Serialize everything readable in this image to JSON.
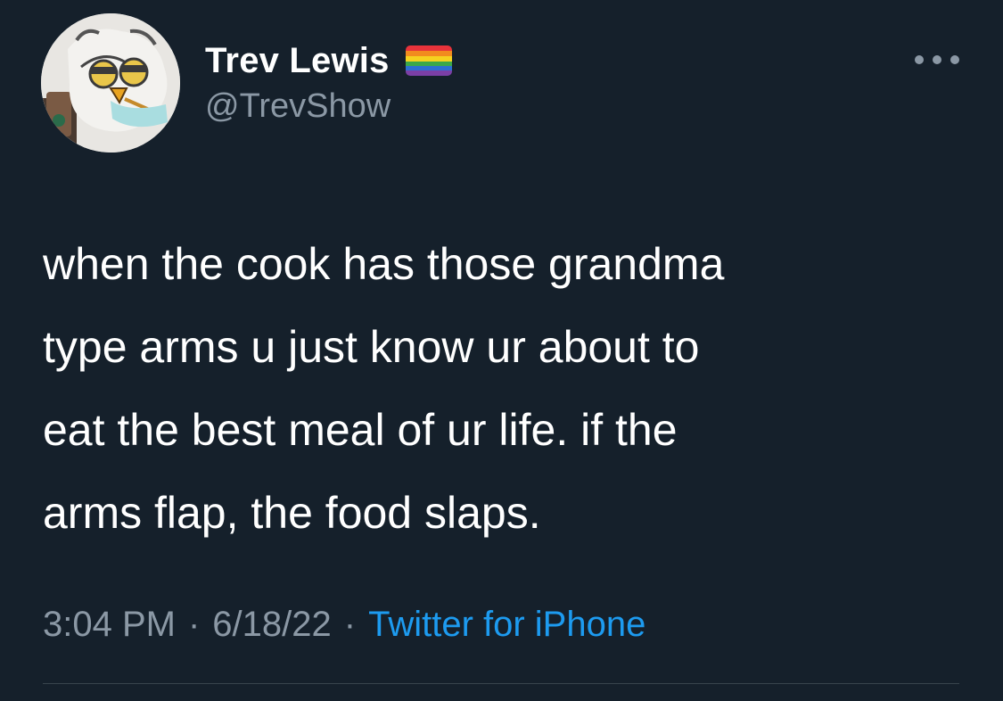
{
  "author": {
    "display_name": "Trev Lewis",
    "handle": "@TrevShow",
    "flag_icon": "rainbow-flag-icon",
    "avatar_icon": "furby-avatar"
  },
  "menu": {
    "icon": "more-options-icon"
  },
  "tweet": {
    "lines": [
      "when the cook has those grandma",
      "type arms u just know ur about to",
      "eat the best meal of ur life. if the",
      "arms flap, the food slaps."
    ],
    "time": "3:04 PM",
    "separator": "·",
    "date": "6/18/22",
    "source": "Twitter for iPhone"
  },
  "colors": {
    "background": "#15202b",
    "primary_text": "#ffffff",
    "secondary_text": "#8b98a5",
    "accent": "#1d9bf0",
    "divider": "#38444d"
  }
}
